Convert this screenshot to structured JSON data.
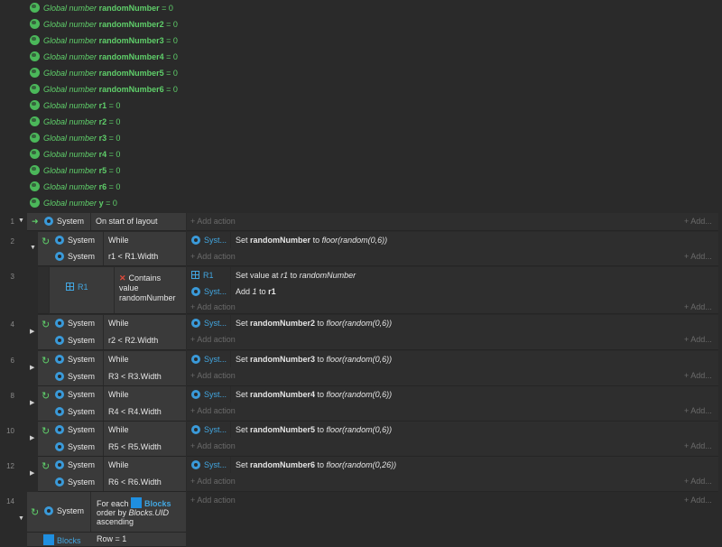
{
  "globals": [
    {
      "prefix": "Global number",
      "name": "randomNumber",
      "value": "= 0"
    },
    {
      "prefix": "Global number",
      "name": "randomNumber2",
      "value": "= 0"
    },
    {
      "prefix": "Global number",
      "name": "randomNumber3",
      "value": "= 0"
    },
    {
      "prefix": "Global number",
      "name": "randomNumber4",
      "value": "= 0"
    },
    {
      "prefix": "Global number",
      "name": "randomNumber5",
      "value": "= 0"
    },
    {
      "prefix": "Global number",
      "name": "randomNumber6",
      "value": "= 0"
    },
    {
      "prefix": "Global number",
      "name": "r1",
      "value": "= 0"
    },
    {
      "prefix": "Global number",
      "name": "r2",
      "value": "= 0"
    },
    {
      "prefix": "Global number",
      "name": "r3",
      "value": "= 0"
    },
    {
      "prefix": "Global number",
      "name": "r4",
      "value": "= 0"
    },
    {
      "prefix": "Global number",
      "name": "r5",
      "value": "= 0"
    },
    {
      "prefix": "Global number",
      "name": "r6",
      "value": "= 0"
    },
    {
      "prefix": "Global number",
      "name": "y",
      "value": "= 0"
    }
  ],
  "labels": {
    "system": "System",
    "syst": "Syst...",
    "add_action": "Add action",
    "add_short": "Add..."
  },
  "event1": {
    "num": "1",
    "condition": "On start of layout"
  },
  "event2": {
    "num": "2",
    "while": "While",
    "cond": "r1 < R1.Width",
    "act_set": "Set",
    "act_var": "randomNumber",
    "act_to": "to",
    "act_expr": "floor(random(0,6))"
  },
  "event3": {
    "num": "3",
    "obj": "R1",
    "contains": "Contains value",
    "contains_var": "randomNumber",
    "act1_obj": "R1",
    "act1_a": "Set value at",
    "act1_b": "r1",
    "act1_c": "to",
    "act1_d": "randomNumber",
    "act2_a": "Add",
    "act2_b": "1",
    "act2_c": "to",
    "act2_d": "r1"
  },
  "loops": [
    {
      "num": "4",
      "while": "While",
      "cond": "r2 < R2.Width",
      "var": "randomNumber2",
      "expr": "floor(random(0,6))"
    },
    {
      "num": "6",
      "while": "While",
      "cond": "R3 < R3.Width",
      "var": "randomNumber3",
      "expr": "floor(random(0,6))"
    },
    {
      "num": "8",
      "while": "While",
      "cond": "R4 < R4.Width",
      "var": "randomNumber4",
      "expr": "floor(random(0,6))"
    },
    {
      "num": "10",
      "while": "While",
      "cond": "R5 < R5.Width",
      "var": "randomNumber5",
      "expr": "floor(random(0,6))"
    },
    {
      "num": "12",
      "while": "While",
      "cond": "R6 < R6.Width",
      "var": "randomNumber6",
      "expr": "floor(random(0,26))"
    }
  ],
  "event14": {
    "num": "14",
    "foreach": "For each",
    "obj": "Blocks",
    "orderby": "order by",
    "orderexpr": "Blocks.UID",
    "asc": "ascending",
    "sub_obj": "Blocks",
    "sub_cond": "Row = 1"
  }
}
